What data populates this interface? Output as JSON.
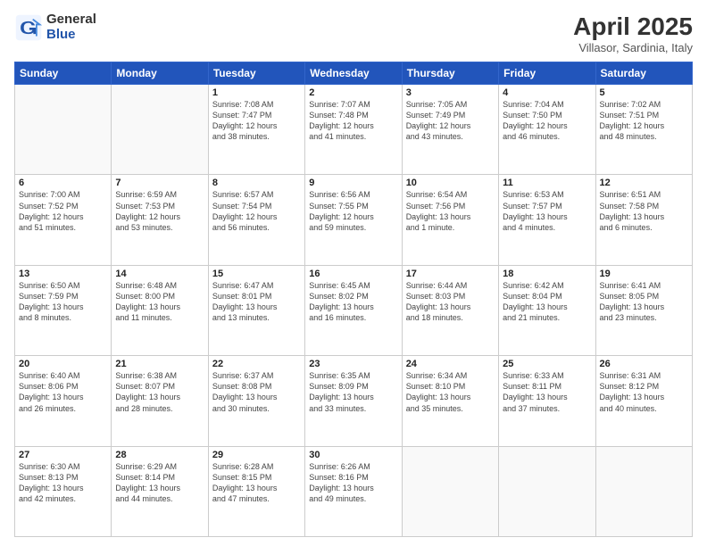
{
  "header": {
    "logo_general": "General",
    "logo_blue": "Blue",
    "title": "April 2025",
    "subtitle": "Villasor, Sardinia, Italy"
  },
  "weekdays": [
    "Sunday",
    "Monday",
    "Tuesday",
    "Wednesday",
    "Thursday",
    "Friday",
    "Saturday"
  ],
  "weeks": [
    [
      {
        "day": "",
        "info": ""
      },
      {
        "day": "",
        "info": ""
      },
      {
        "day": "1",
        "info": "Sunrise: 7:08 AM\nSunset: 7:47 PM\nDaylight: 12 hours\nand 38 minutes."
      },
      {
        "day": "2",
        "info": "Sunrise: 7:07 AM\nSunset: 7:48 PM\nDaylight: 12 hours\nand 41 minutes."
      },
      {
        "day": "3",
        "info": "Sunrise: 7:05 AM\nSunset: 7:49 PM\nDaylight: 12 hours\nand 43 minutes."
      },
      {
        "day": "4",
        "info": "Sunrise: 7:04 AM\nSunset: 7:50 PM\nDaylight: 12 hours\nand 46 minutes."
      },
      {
        "day": "5",
        "info": "Sunrise: 7:02 AM\nSunset: 7:51 PM\nDaylight: 12 hours\nand 48 minutes."
      }
    ],
    [
      {
        "day": "6",
        "info": "Sunrise: 7:00 AM\nSunset: 7:52 PM\nDaylight: 12 hours\nand 51 minutes."
      },
      {
        "day": "7",
        "info": "Sunrise: 6:59 AM\nSunset: 7:53 PM\nDaylight: 12 hours\nand 53 minutes."
      },
      {
        "day": "8",
        "info": "Sunrise: 6:57 AM\nSunset: 7:54 PM\nDaylight: 12 hours\nand 56 minutes."
      },
      {
        "day": "9",
        "info": "Sunrise: 6:56 AM\nSunset: 7:55 PM\nDaylight: 12 hours\nand 59 minutes."
      },
      {
        "day": "10",
        "info": "Sunrise: 6:54 AM\nSunset: 7:56 PM\nDaylight: 13 hours\nand 1 minute."
      },
      {
        "day": "11",
        "info": "Sunrise: 6:53 AM\nSunset: 7:57 PM\nDaylight: 13 hours\nand 4 minutes."
      },
      {
        "day": "12",
        "info": "Sunrise: 6:51 AM\nSunset: 7:58 PM\nDaylight: 13 hours\nand 6 minutes."
      }
    ],
    [
      {
        "day": "13",
        "info": "Sunrise: 6:50 AM\nSunset: 7:59 PM\nDaylight: 13 hours\nand 8 minutes."
      },
      {
        "day": "14",
        "info": "Sunrise: 6:48 AM\nSunset: 8:00 PM\nDaylight: 13 hours\nand 11 minutes."
      },
      {
        "day": "15",
        "info": "Sunrise: 6:47 AM\nSunset: 8:01 PM\nDaylight: 13 hours\nand 13 minutes."
      },
      {
        "day": "16",
        "info": "Sunrise: 6:45 AM\nSunset: 8:02 PM\nDaylight: 13 hours\nand 16 minutes."
      },
      {
        "day": "17",
        "info": "Sunrise: 6:44 AM\nSunset: 8:03 PM\nDaylight: 13 hours\nand 18 minutes."
      },
      {
        "day": "18",
        "info": "Sunrise: 6:42 AM\nSunset: 8:04 PM\nDaylight: 13 hours\nand 21 minutes."
      },
      {
        "day": "19",
        "info": "Sunrise: 6:41 AM\nSunset: 8:05 PM\nDaylight: 13 hours\nand 23 minutes."
      }
    ],
    [
      {
        "day": "20",
        "info": "Sunrise: 6:40 AM\nSunset: 8:06 PM\nDaylight: 13 hours\nand 26 minutes."
      },
      {
        "day": "21",
        "info": "Sunrise: 6:38 AM\nSunset: 8:07 PM\nDaylight: 13 hours\nand 28 minutes."
      },
      {
        "day": "22",
        "info": "Sunrise: 6:37 AM\nSunset: 8:08 PM\nDaylight: 13 hours\nand 30 minutes."
      },
      {
        "day": "23",
        "info": "Sunrise: 6:35 AM\nSunset: 8:09 PM\nDaylight: 13 hours\nand 33 minutes."
      },
      {
        "day": "24",
        "info": "Sunrise: 6:34 AM\nSunset: 8:10 PM\nDaylight: 13 hours\nand 35 minutes."
      },
      {
        "day": "25",
        "info": "Sunrise: 6:33 AM\nSunset: 8:11 PM\nDaylight: 13 hours\nand 37 minutes."
      },
      {
        "day": "26",
        "info": "Sunrise: 6:31 AM\nSunset: 8:12 PM\nDaylight: 13 hours\nand 40 minutes."
      }
    ],
    [
      {
        "day": "27",
        "info": "Sunrise: 6:30 AM\nSunset: 8:13 PM\nDaylight: 13 hours\nand 42 minutes."
      },
      {
        "day": "28",
        "info": "Sunrise: 6:29 AM\nSunset: 8:14 PM\nDaylight: 13 hours\nand 44 minutes."
      },
      {
        "day": "29",
        "info": "Sunrise: 6:28 AM\nSunset: 8:15 PM\nDaylight: 13 hours\nand 47 minutes."
      },
      {
        "day": "30",
        "info": "Sunrise: 6:26 AM\nSunset: 8:16 PM\nDaylight: 13 hours\nand 49 minutes."
      },
      {
        "day": "",
        "info": ""
      },
      {
        "day": "",
        "info": ""
      },
      {
        "day": "",
        "info": ""
      }
    ]
  ]
}
